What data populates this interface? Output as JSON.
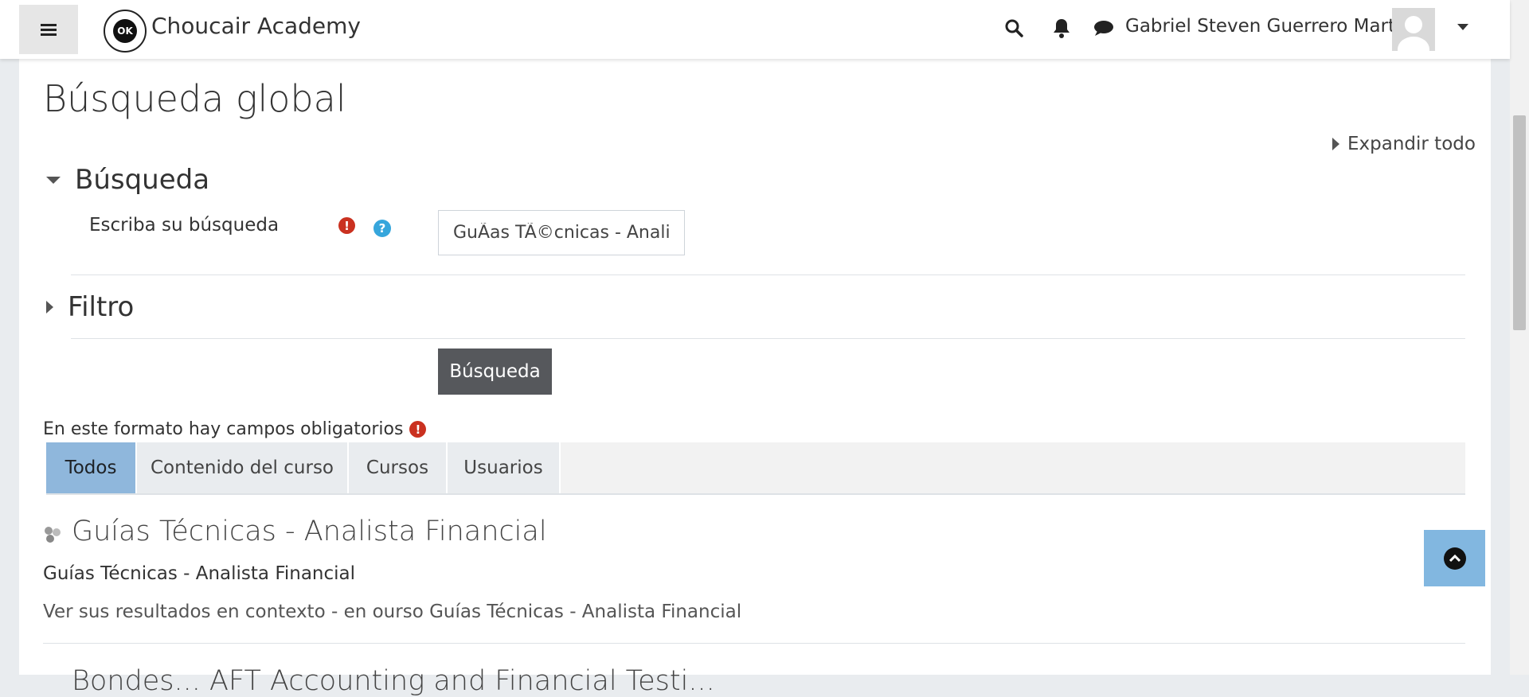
{
  "header": {
    "brand": "Choucair Academy",
    "logo_text": "OK",
    "user_name": "Gabriel Steven Guerrero Martin"
  },
  "page": {
    "title": "Búsqueda global",
    "expand_all": "Expandir todo"
  },
  "search_section": {
    "heading": "Búsqueda",
    "field_label": "Escriba su búsqueda",
    "field_value": "GuÃas TÃ©cnicas - Analis",
    "required_symbol": "!",
    "help_symbol": "?"
  },
  "filter_section": {
    "heading": "Filtro"
  },
  "submit_label": "Búsqueda",
  "required_note": "En este formato hay campos obligatorios",
  "tabs": [
    {
      "label": "Todos",
      "active": true
    },
    {
      "label": "Contenido del curso",
      "active": false
    },
    {
      "label": "Cursos",
      "active": false
    },
    {
      "label": "Usuarios",
      "active": false
    }
  ],
  "results": [
    {
      "title": "Guías Técnicas - Analista Financial",
      "subtitle": "Guías Técnicas - Analista Financial",
      "context": "Ver sus resultados en contexto - en ourso Guías Técnicas - Analista Financial"
    }
  ],
  "next_result_partial": "Bondes... AFT Accounting and Financial Testi...",
  "colors": {
    "active_tab": "#8fb7dc",
    "button": "#56585c",
    "required": "#ca3120",
    "help": "#36a6dc",
    "back_to_top": "#82b7e0"
  },
  "icons": [
    "menu-icon",
    "search-icon",
    "bell-icon",
    "chat-icon",
    "chevron-down-icon",
    "required-icon",
    "help-icon",
    "course-icon",
    "arrow-up-icon"
  ]
}
